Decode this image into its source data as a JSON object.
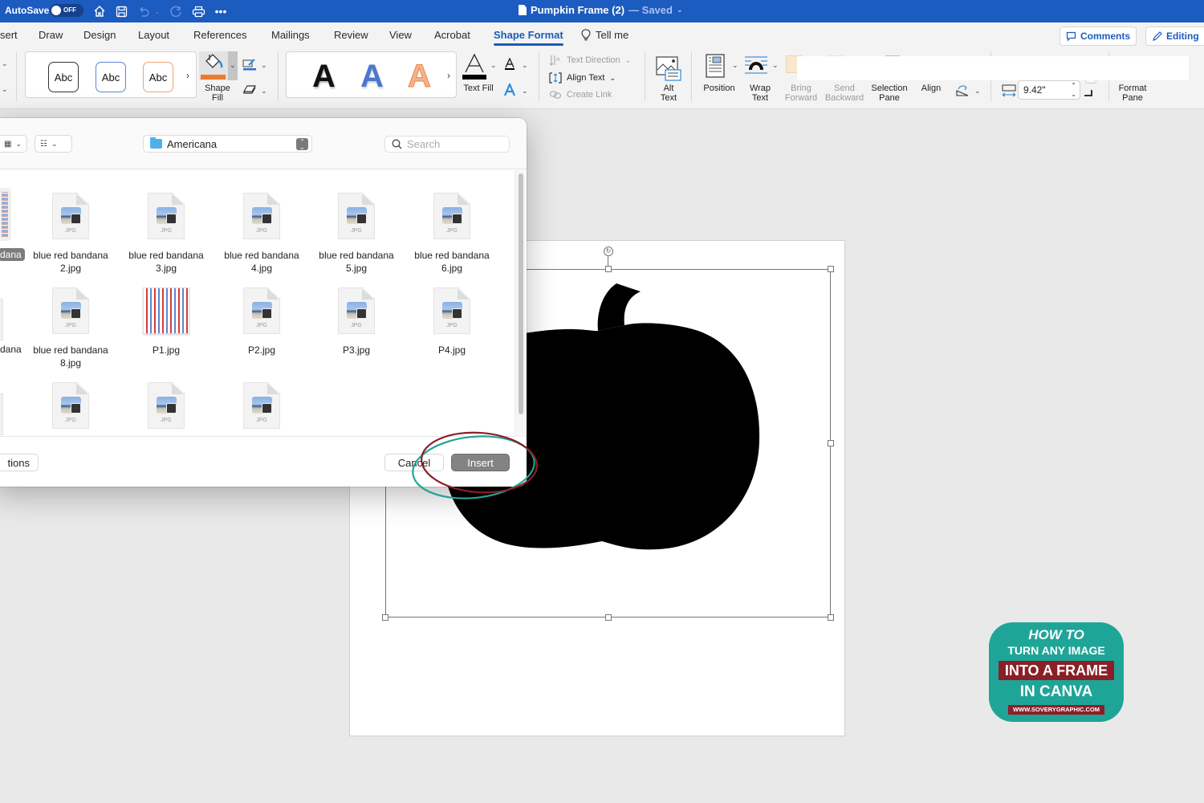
{
  "titlebar": {
    "autosave_label": "AutoSave",
    "autosave_state": "OFF",
    "doc_name": "Pumpkin Frame (2)",
    "doc_status": "— Saved",
    "quick_access": [
      "home-icon",
      "save-icon",
      "undo-icon",
      "redo-icon",
      "print-icon",
      "more-icon"
    ]
  },
  "tabs": {
    "items": [
      "sert",
      "Draw",
      "Design",
      "Layout",
      "References",
      "Mailings",
      "Review",
      "View",
      "Acrobat",
      "Shape Format"
    ],
    "active": "Shape Format",
    "tell_me": "Tell me",
    "comments_label": "Comments",
    "editing_label": "Editing"
  },
  "ribbon": {
    "shape_styles": [
      "Abc",
      "Abc",
      "Abc"
    ],
    "shape_fill_label_1": "Shape",
    "shape_fill_label_2": "Fill",
    "shape_fill_color": "#ec7a2c",
    "wordart": [
      "A",
      "A",
      "A"
    ],
    "text_fill_label": "Text Fill",
    "text_direction": "Text Direction",
    "align_text": "Align Text",
    "create_link": "Create Link",
    "alt_text_1": "Alt",
    "alt_text_2": "Text",
    "position": "Position",
    "wrap_text_1": "Wrap",
    "wrap_text_2": "Text",
    "bring_forward_1": "Bring",
    "bring_forward_2": "Forward",
    "send_backward_1": "Send",
    "send_backward_2": "Backward",
    "selection_pane_1": "Selection",
    "selection_pane_2": "Pane",
    "align": "Align",
    "width_value": "9.42\"",
    "format_pane_1": "Format",
    "format_pane_2": "Pane"
  },
  "dialog": {
    "location": "Americana",
    "search_placeholder": "Search",
    "partial_labels": [
      "dana",
      "dana"
    ],
    "files": [
      {
        "name": "blue red bandana 2.jpg",
        "type": "JPG"
      },
      {
        "name": "blue red bandana 3.jpg",
        "type": "JPG"
      },
      {
        "name": "blue red bandana 4.jpg",
        "type": "JPG"
      },
      {
        "name": "blue red bandana 5.jpg",
        "type": "JPG"
      },
      {
        "name": "blue red bandana 6.jpg",
        "type": "JPG"
      },
      {
        "name": "blue red bandana 8.jpg",
        "type": "JPG"
      },
      {
        "name": "P1.jpg",
        "type": "stripes"
      },
      {
        "name": "P2.jpg",
        "type": "JPG"
      },
      {
        "name": "P3.jpg",
        "type": "JPG"
      },
      {
        "name": "P4.jpg",
        "type": "JPG"
      },
      {
        "name": "",
        "type": "JPG"
      },
      {
        "name": "",
        "type": "JPG"
      },
      {
        "name": "",
        "type": "JPG"
      }
    ],
    "options_label": "tions",
    "cancel_label": "Cancel",
    "insert_label": "Insert"
  },
  "badge": {
    "line1": "HOW TO",
    "line2": "TURN ANY IMAGE",
    "line3": "INTO A FRAME",
    "line4": "IN CANVA",
    "line5": "WWW.SOVERYGRAPHIC.COM"
  },
  "colors": {
    "accent": "#1c5bbf",
    "annotation_red": "#8b1f27",
    "annotation_teal": "#1fa598"
  }
}
